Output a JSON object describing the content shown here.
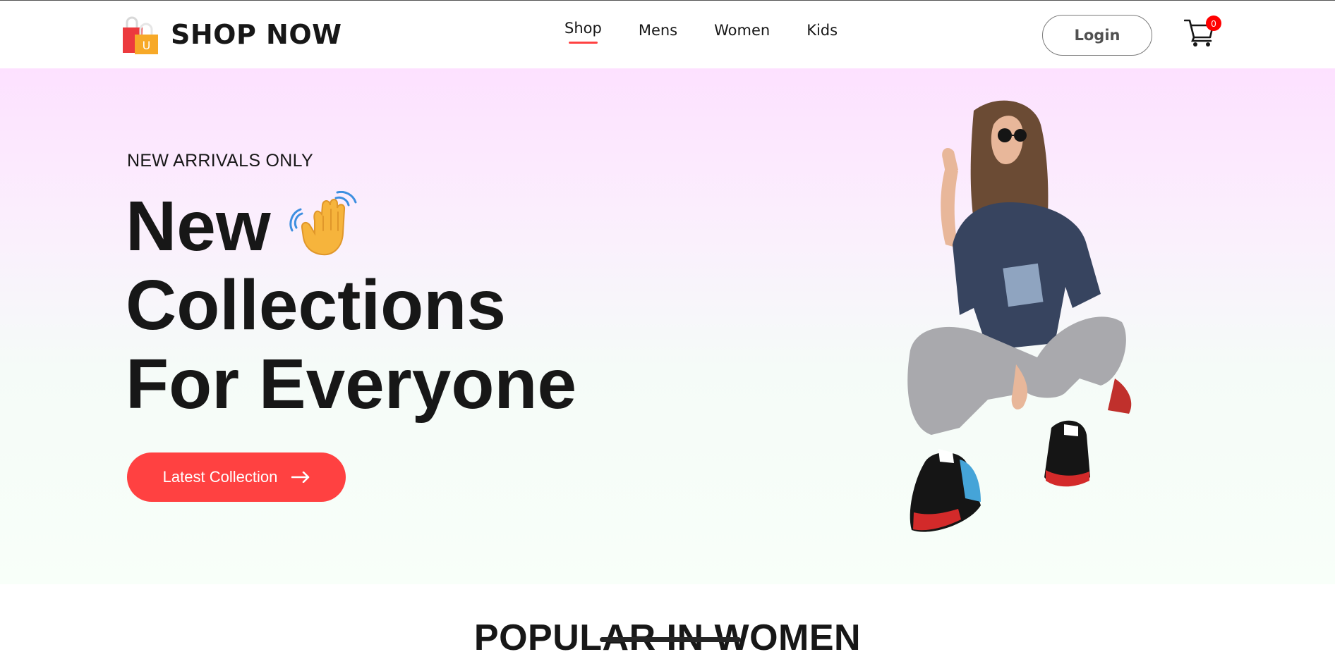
{
  "brand": {
    "name": "SHOP NOW",
    "logo_letter": "U",
    "accent_color": "#ff4141"
  },
  "nav": {
    "items": [
      {
        "label": "Shop",
        "active": true
      },
      {
        "label": "Mens",
        "active": false
      },
      {
        "label": "Women",
        "active": false
      },
      {
        "label": "Kids",
        "active": false
      }
    ]
  },
  "header": {
    "login_label": "Login",
    "cart_count": "0",
    "cart_icon": "cart-icon"
  },
  "hero": {
    "eyebrow": "NEW ARRIVALS ONLY",
    "title_lines": [
      "New",
      "Collections",
      "For Everyone"
    ],
    "emoji_icon": "waving-hand-icon",
    "cta_label": "Latest Collection",
    "cta_icon": "arrow-right-icon",
    "background_gradient": [
      "#fde1ff",
      "#f8fff9"
    ]
  },
  "section": {
    "title": "POPULAR IN WOMEN"
  }
}
